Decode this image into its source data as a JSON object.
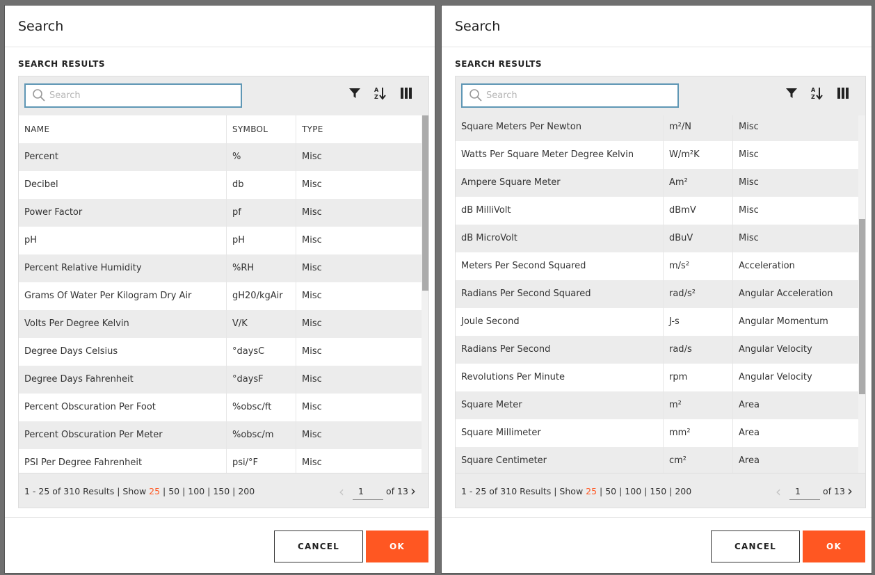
{
  "colors": {
    "accent": "#ff5722",
    "search_border": "#5f97b5",
    "row_alt": "#ececec"
  },
  "dialogs": [
    {
      "title": "Search",
      "section_label": "SEARCH RESULTS",
      "search_placeholder": "Search",
      "scroll_position": 0,
      "columns": [
        "NAME",
        "SYMBOL",
        "TYPE"
      ],
      "show_header": true,
      "rows": [
        [
          "Percent",
          "%",
          "Misc"
        ],
        [
          "Decibel",
          "db",
          "Misc"
        ],
        [
          "Power Factor",
          "pf",
          "Misc"
        ],
        [
          "pH",
          "pH",
          "Misc"
        ],
        [
          "Percent Relative Humidity",
          "%RH",
          "Misc"
        ],
        [
          "Grams Of Water Per Kilogram Dry Air",
          "gH20/kgAir",
          "Misc"
        ],
        [
          "Volts Per Degree Kelvin",
          "V/K",
          "Misc"
        ],
        [
          "Degree Days Celsius",
          "°daysC",
          "Misc"
        ],
        [
          "Degree Days Fahrenheit",
          "°daysF",
          "Misc"
        ],
        [
          "Percent Obscuration Per Foot",
          "%obsc/ft",
          "Misc"
        ],
        [
          "Percent Obscuration Per Meter",
          "%obsc/m",
          "Misc"
        ],
        [
          "PSI Per Degree Fahrenheit",
          "psi/°F",
          "Misc"
        ]
      ],
      "footer": {
        "results_prefix": "1 - 25 of 310 Results | Show ",
        "page_sizes": [
          "25",
          "50",
          "100",
          "150",
          "200"
        ],
        "active_page_size": "25",
        "page_value": "1",
        "of_pages": "of 13"
      },
      "cancel_label": "CANCEL",
      "ok_label": "OK"
    },
    {
      "title": "Search",
      "section_label": "SEARCH RESULTS",
      "search_placeholder": "Search",
      "scroll_position": 0.57,
      "columns": [
        "NAME",
        "SYMBOL",
        "TYPE"
      ],
      "show_header": false,
      "rows": [
        [
          "Square Meters Per Newton",
          "m²/N",
          "Misc"
        ],
        [
          "Watts Per Square Meter Degree Kelvin",
          "W/m²K",
          "Misc"
        ],
        [
          "Ampere Square Meter",
          "Am²",
          "Misc"
        ],
        [
          "dB MilliVolt",
          "dBmV",
          "Misc"
        ],
        [
          "dB MicroVolt",
          "dBuV",
          "Misc"
        ],
        [
          "Meters Per Second Squared",
          "m/s²",
          "Acceleration"
        ],
        [
          "Radians Per Second Squared",
          "rad/s²",
          "Angular Acceleration"
        ],
        [
          "Joule Second",
          "J-s",
          "Angular Momentum"
        ],
        [
          "Radians Per Second",
          "rad/s",
          "Angular Velocity"
        ],
        [
          "Revolutions Per Minute",
          "rpm",
          "Angular Velocity"
        ],
        [
          "Square Meter",
          "m²",
          "Area"
        ],
        [
          "Square Millimeter",
          "mm²",
          "Area"
        ],
        [
          "Square Centimeter",
          "cm²",
          "Area"
        ]
      ],
      "footer": {
        "results_prefix": "1 - 25 of 310 Results | Show ",
        "page_sizes": [
          "25",
          "50",
          "100",
          "150",
          "200"
        ],
        "active_page_size": "25",
        "page_value": "1",
        "of_pages": "of 13"
      },
      "cancel_label": "CANCEL",
      "ok_label": "OK"
    }
  ]
}
